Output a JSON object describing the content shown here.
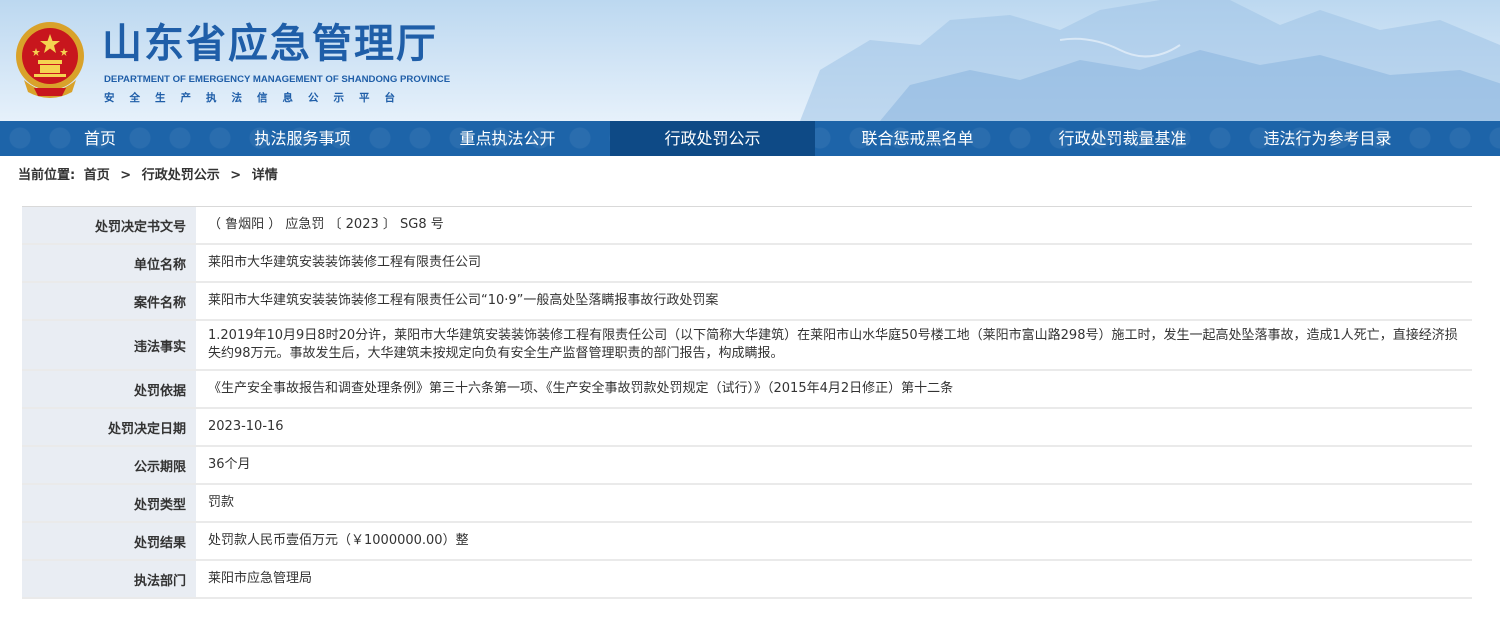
{
  "header": {
    "title": "山东省应急管理厅",
    "subtitle_en": "DEPARTMENT OF EMERGENCY MANAGEMENT OF SHANDONG PROVINCE",
    "platform": "安全生产执法信息公示平台",
    "emblem_icon": "national-emblem-icon",
    "colors": {
      "title": "#1f5ea8",
      "nav_bg": "#1d64a9",
      "nav_active": "#0e4a86"
    }
  },
  "nav": {
    "items": [
      {
        "label": "首页"
      },
      {
        "label": "执法服务事项"
      },
      {
        "label": "重点执法公开"
      },
      {
        "label": "行政处罚公示"
      },
      {
        "label": "联合惩戒黑名单"
      },
      {
        "label": "行政处罚裁量基准"
      },
      {
        "label": "违法行为参考目录"
      }
    ],
    "active_index": 3
  },
  "breadcrumb": {
    "prefix": "当前位置:",
    "items": [
      "首页",
      "行政处罚公示",
      "详情"
    ],
    "separator": ">"
  },
  "detail": {
    "rows": [
      {
        "label": "处罚决定书文号",
        "value": "（ 鲁烟阳 ） 应急罚 〔 2023 〕 SG8 号"
      },
      {
        "label": "单位名称",
        "value": "莱阳市大华建筑安装装饰装修工程有限责任公司"
      },
      {
        "label": "案件名称",
        "value": "莱阳市大华建筑安装装饰装修工程有限责任公司“10·9”一般高处坠落瞒报事故行政处罚案"
      },
      {
        "label": "违法事实",
        "value": "1.2019年10月9日8时20分许，莱阳市大华建筑安装装饰装修工程有限责任公司（以下简称大华建筑）在莱阳市山水华庭50号楼工地（莱阳市富山路298号）施工时，发生一起高处坠落事故，造成1人死亡，直接经济损失约98万元。事故发生后，大华建筑未按规定向负有安全生产监督管理职责的部门报告，构成瞒报。"
      },
      {
        "label": "处罚依据",
        "value": "《生产安全事故报告和调查处理条例》第三十六条第一项、《生产安全事故罚款处罚规定（试行）》（2015年4月2日修正）第十二条"
      },
      {
        "label": "处罚决定日期",
        "value": "2023-10-16"
      },
      {
        "label": "公示期限",
        "value": "36个月"
      },
      {
        "label": "处罚类型",
        "value": "罚款"
      },
      {
        "label": "处罚结果",
        "value": "处罚款人民币壹佰万元（￥1000000.00）整"
      },
      {
        "label": "执法部门",
        "value": "莱阳市应急管理局"
      }
    ]
  }
}
